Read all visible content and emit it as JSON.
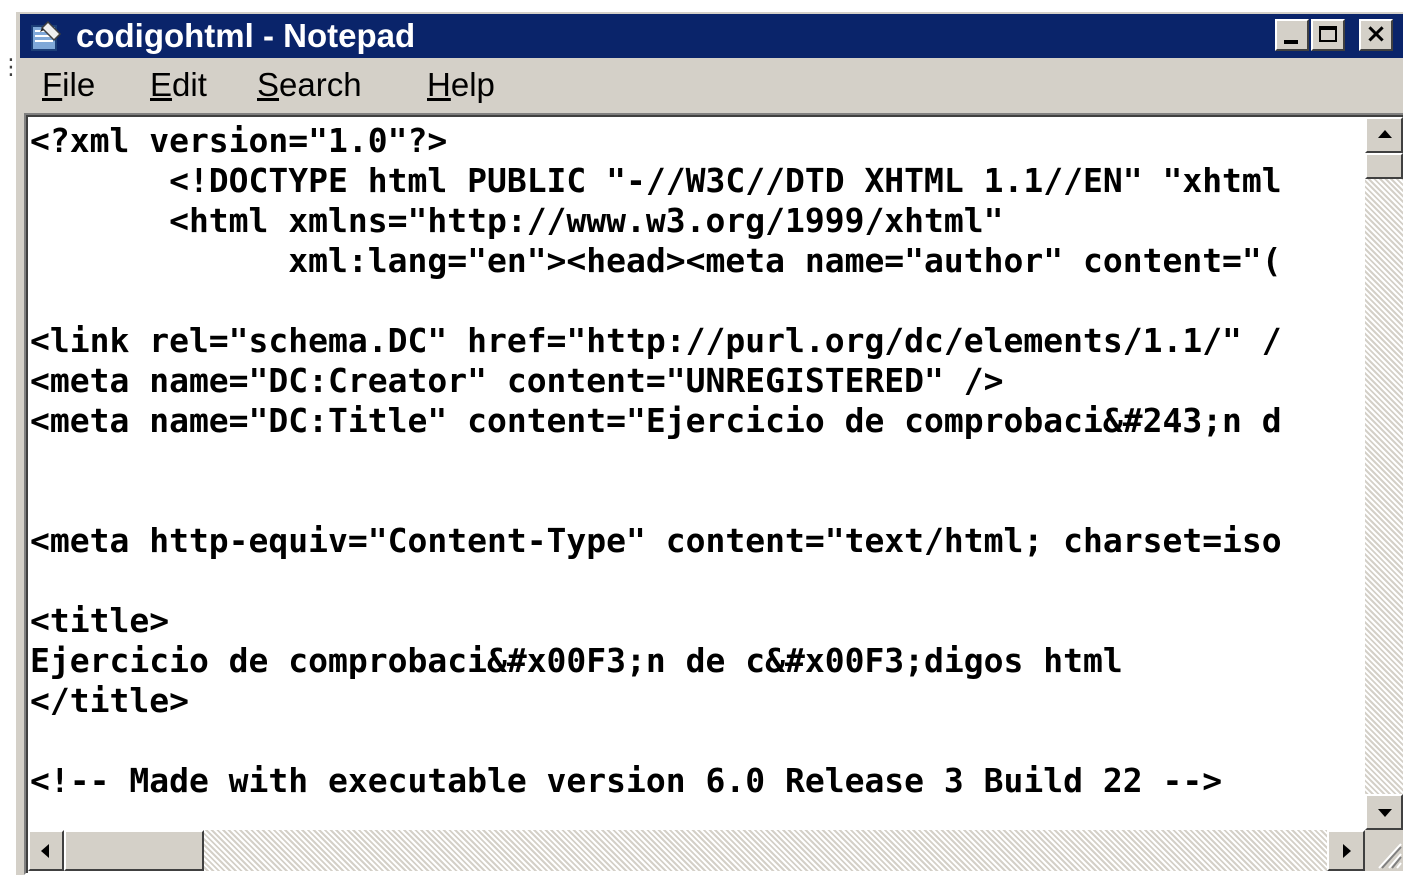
{
  "window": {
    "title": "codigohtml - Notepad",
    "buttons": {
      "minimize": "minimize-icon",
      "maximize": "maximize-icon",
      "close": "×"
    }
  },
  "menu": {
    "items": [
      {
        "first": "F",
        "rest": "ile"
      },
      {
        "first": "E",
        "rest": "dit"
      },
      {
        "first": "S",
        "rest": "earch"
      },
      {
        "first": "H",
        "rest": "elp"
      }
    ]
  },
  "editor": {
    "lines": [
      "<?xml version=\"1.0\"?>",
      "       <!DOCTYPE html PUBLIC \"-//W3C//DTD XHTML 1.1//EN\" \"xhtml",
      "       <html xmlns=\"http://www.w3.org/1999/xhtml\"",
      "             xml:lang=\"en\"><head><meta name=\"author\" content=\"(",
      "",
      "<link rel=\"schema.DC\" href=\"http://purl.org/dc/elements/1.1/\" /",
      "<meta name=\"DC:Creator\" content=\"UNREGISTERED\" />",
      "<meta name=\"DC:Title\" content=\"Ejercicio de comprobaci&#243;n d",
      "",
      "",
      "<meta http-equiv=\"Content-Type\" content=\"text/html; charset=iso",
      "",
      "<title>",
      "Ejercicio de comprobaci&#x00F3;n de c&#x00F3;digos html",
      "</title>",
      "",
      "<!-- Made with executable version 6.0 Release 3 Build 22 -->"
    ]
  },
  "colors": {
    "titlebar": "#0a246a",
    "chrome": "#d4d0c8",
    "text": "#000000",
    "background": "#ffffff"
  }
}
